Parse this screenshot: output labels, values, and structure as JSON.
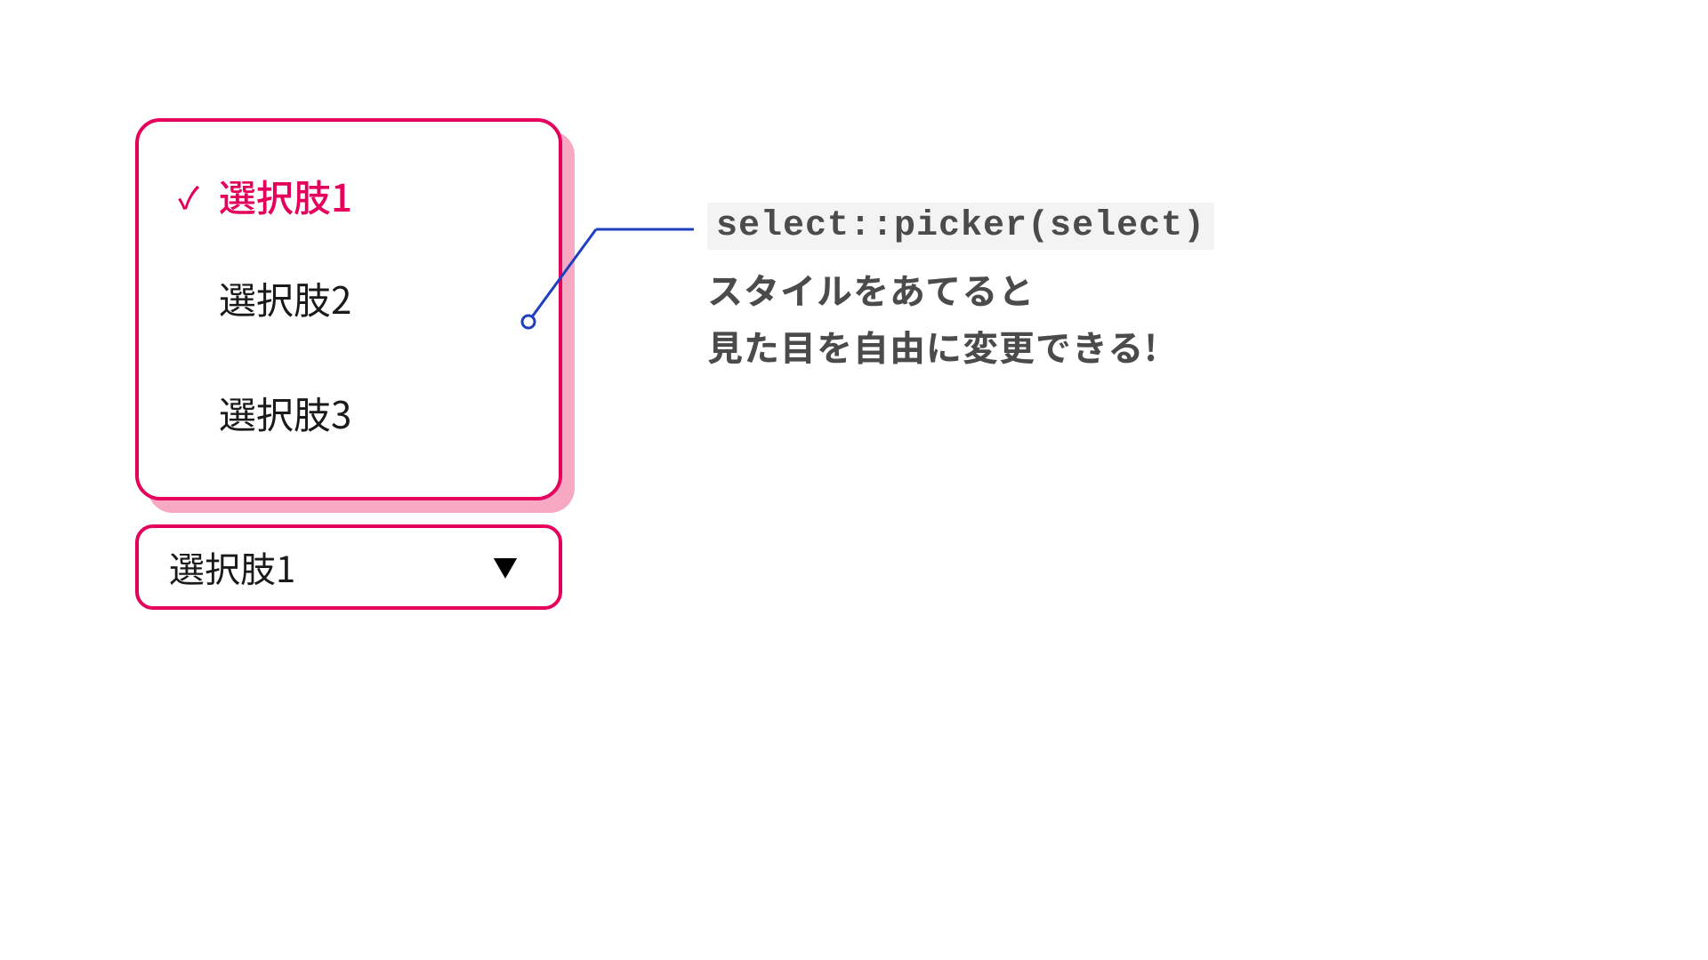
{
  "picker": {
    "options": [
      {
        "label": "選択肢1",
        "selected": true
      },
      {
        "label": "選択肢2",
        "selected": false
      },
      {
        "label": "選択肢3",
        "selected": false
      }
    ]
  },
  "select": {
    "value": "選択肢1"
  },
  "annotation": {
    "code": "select::picker(select)",
    "line1": "スタイルをあてると",
    "line2": "見た目を自由に変更できる!"
  }
}
